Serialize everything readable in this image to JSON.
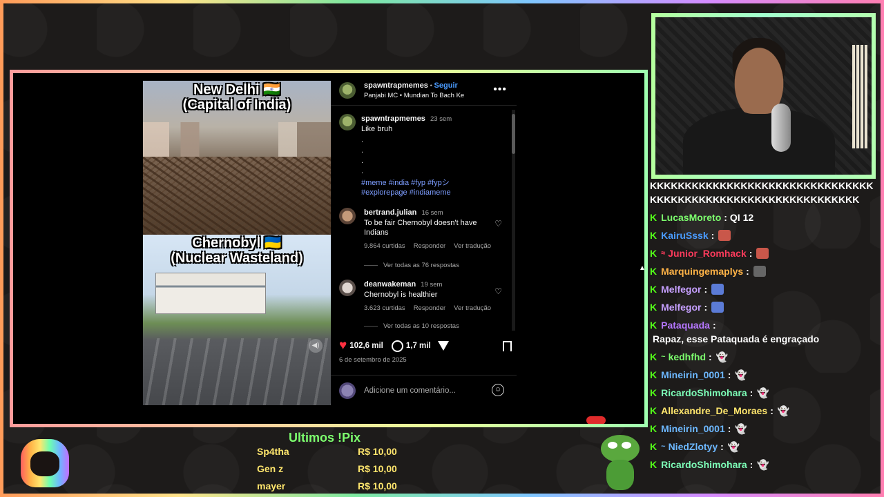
{
  "post": {
    "video": {
      "caption_top": "New Delhi 🇮🇳\n(Capital of India)",
      "caption_bottom": "Chernobyl 🇺🇦\n(Nuclear Wasteland)"
    },
    "header": {
      "username": "spawntrapmemes",
      "separator": " • ",
      "follow_label": "Seguir",
      "audio": "Panjabi MC • Mundian To Bach Ke",
      "more_label": "•••"
    },
    "caption": {
      "username": "spawntrapmemes",
      "age": "23 sem",
      "text": "Like bruh",
      "dots": ".\n.\n.\n.",
      "hashtags": "#meme #india #fyp #fypシ\n#explorepage #indiameme"
    },
    "comments": [
      {
        "username": "bertrand.julian",
        "age": "16 sem",
        "text": "To be fair Chernobyl doesn't have Indians",
        "likes": "9.864 curtidas",
        "reply": "Responder",
        "translate": "Ver tradução",
        "replies": "Ver todas as 76 respostas"
      },
      {
        "username": "deanwakeman",
        "age": "19 sem",
        "text": "Chernobyl is healthier",
        "likes": "3.623 curtidas",
        "reply": "Responder",
        "translate": "Ver tradução",
        "replies": "Ver todas as 10 respostas"
      }
    ],
    "actions": {
      "like_count": "102,6 mil",
      "comment_count": "1,7 mil"
    },
    "date": "6 de setembro de 2025",
    "add_comment_placeholder": "Adicione um comentário..."
  },
  "chat": {
    "spam": "KKKKKKKKKKKKKKKKKKKKKKKKKKKKKKKKKKKKKKKKKKKKKKKKKKKKKKKKKKKKKK",
    "messages": [
      {
        "name": "LucasMoreto",
        "color": "#7dff6e",
        "text": "QI 12",
        "emote": ""
      },
      {
        "name": "KairuSssk",
        "color": "#4a9bff",
        "text": "",
        "emote": "#c9574a"
      },
      {
        "name": "Junior_Romhack",
        "color": "#ff3b5c",
        "text": "",
        "emote": "#c9574a",
        "badge": "≈"
      },
      {
        "name": "Marquingemaplys",
        "color": "#ffb347",
        "text": "",
        "emote": "#666666"
      },
      {
        "name": "Melfegor",
        "color": "#c6a0ff",
        "text": "",
        "emote": "#5b7bd6"
      },
      {
        "name": "Melfegor",
        "color": "#c6a0ff",
        "text": "",
        "emote": "#5b7bd6"
      },
      {
        "name": "Pataquada",
        "color": "#b576ff",
        "text": "Rapaz, esse Pataquada é engraçado",
        "emote": ""
      },
      {
        "name": "kedhfhd",
        "color": "#7dff6e",
        "text": "",
        "ghost": "👻",
        "badge": "~"
      },
      {
        "name": "Mineirin_0001",
        "color": "#6db8ff",
        "text": "",
        "ghost": "👻"
      },
      {
        "name": "RicardoShimohara",
        "color": "#7dffb8",
        "text": "",
        "ghost": "👻"
      },
      {
        "name": "Allexandre_De_Moraes",
        "color": "#ffe66d",
        "text": "",
        "ghost": "👻"
      },
      {
        "name": "Mineirin_0001",
        "color": "#6db8ff",
        "text": "",
        "ghost": "👻"
      },
      {
        "name": "NiedZlotyy",
        "color": "#6db8ff",
        "text": "",
        "ghost": "👻",
        "badge": "~"
      },
      {
        "name": "RicardoShimohara",
        "color": "#7dffb8",
        "text": "",
        "ghost": "👻"
      }
    ]
  },
  "pix": {
    "title": "Ultimos !Pix",
    "rows": [
      {
        "name": "Sp4tha",
        "amount": "R$ 10,00"
      },
      {
        "name": "Gen z",
        "amount": "R$ 10,00"
      },
      {
        "name": "mayer",
        "amount": "R$ 10,00"
      }
    ]
  },
  "colors": {
    "kick_green": "#53fc18",
    "instagram_blue": "#4a9bff",
    "like_red": "#ff3040"
  }
}
